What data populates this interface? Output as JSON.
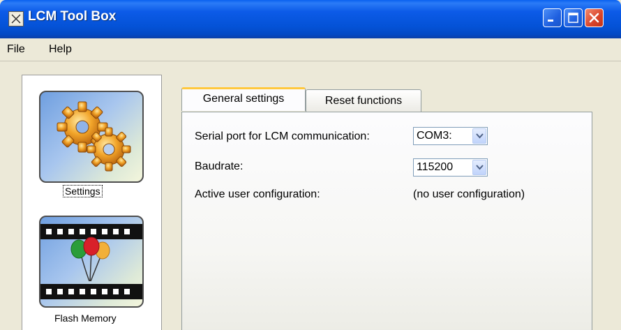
{
  "window": {
    "title": "LCM Tool Box"
  },
  "menu": {
    "file": "File",
    "help": "Help"
  },
  "sidebar": {
    "items": [
      {
        "label": "Settings",
        "icon": "gears-icon"
      },
      {
        "label": "Flash Memory",
        "icon": "film-balloons-icon"
      }
    ]
  },
  "tabs": [
    {
      "label": "General settings",
      "active": true
    },
    {
      "label": "Reset functions",
      "active": false
    }
  ],
  "general": {
    "serial_port_label": "Serial port for LCM communication:",
    "serial_port_value": "COM3:",
    "baudrate_label": "Baudrate:",
    "baudrate_value": "115200",
    "active_config_label": "Active user configuration:",
    "active_config_value": "(no user configuration)"
  },
  "colors": {
    "titlebar": "#0452d6",
    "tab_highlight": "#ffc83d",
    "close_button": "#d9442a"
  }
}
